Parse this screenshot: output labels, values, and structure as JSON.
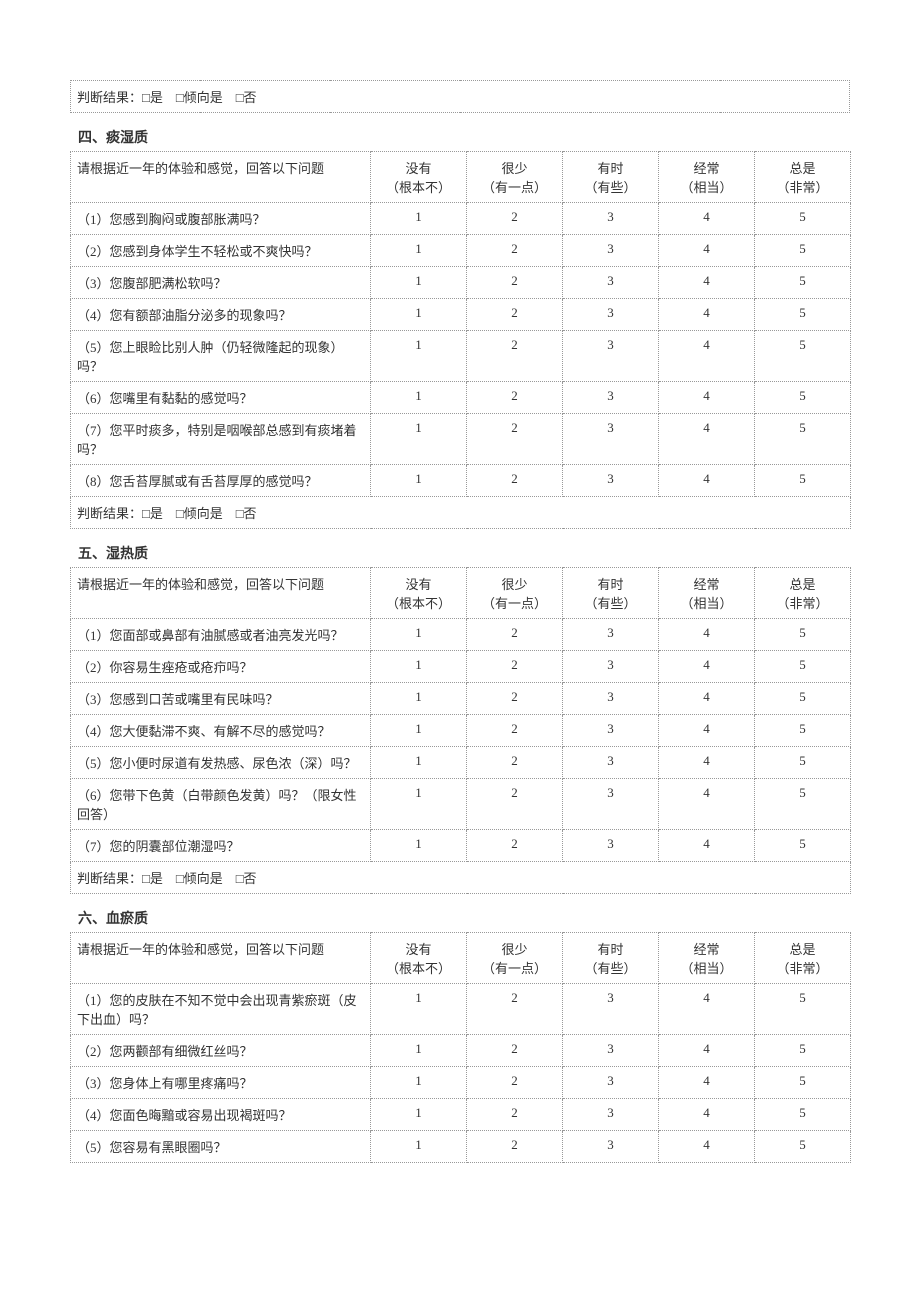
{
  "header_cols": [
    {
      "label": "没有",
      "sub": "（根本不）"
    },
    {
      "label": "很少",
      "sub": "（有一点）"
    },
    {
      "label": "有时",
      "sub": "（有些）"
    },
    {
      "label": "经常",
      "sub": "（相当）"
    },
    {
      "label": "总是",
      "sub": "（非常）"
    }
  ],
  "prompt": "请根据近一年的体验和感觉，回答以下问题",
  "judgement_label": "判断结果：□是　□倾向是　□否",
  "sections": [
    {
      "title": "",
      "questions": [],
      "judgement_only": true
    },
    {
      "title": "四、痰湿质",
      "questions": [
        "（1）您感到胸闷或腹部胀满吗？",
        "（2）您感到身体学生不轻松或不爽快吗？",
        "（3）您腹部肥满松软吗？",
        "（4）您有额部油脂分泌多的现象吗？",
        "（5）您上眼睑比别人肿（仍轻微隆起的现象）吗？",
        "（6）您嘴里有黏黏的感觉吗？",
        "（7）您平时痰多，特别是咽喉部总感到有痰堵着吗？",
        "（8）您舌苔厚腻或有舌苔厚厚的感觉吗？"
      ]
    },
    {
      "title": "五、湿热质",
      "questions": [
        "（1）您面部或鼻部有油腻感或者油亮发光吗？",
        "（2）你容易生痤疮或疮疖吗？",
        "（3）您感到口苦或嘴里有民味吗？",
        "（4）您大便黏滞不爽、有解不尽的感觉吗？",
        "（5）您小便时尿道有发热感、尿色浓（深）吗？",
        "（6）您带下色黄（白带颜色发黄）吗？（限女性回答）",
        "（7）您的阴囊部位潮湿吗？"
      ]
    },
    {
      "title": "六、血瘀质",
      "questions": [
        "（1）您的皮肤在不知不觉中会出现青紫瘀斑（皮下出血）吗？",
        "（2）您两颧部有细微红丝吗？",
        "（3）您身体上有哪里疼痛吗？",
        "（4）您面色晦黯或容易出现褐斑吗？",
        "（5）您容易有黑眼圈吗？"
      ],
      "no_judgement": true
    }
  ],
  "scale": [
    1,
    2,
    3,
    4,
    5
  ]
}
